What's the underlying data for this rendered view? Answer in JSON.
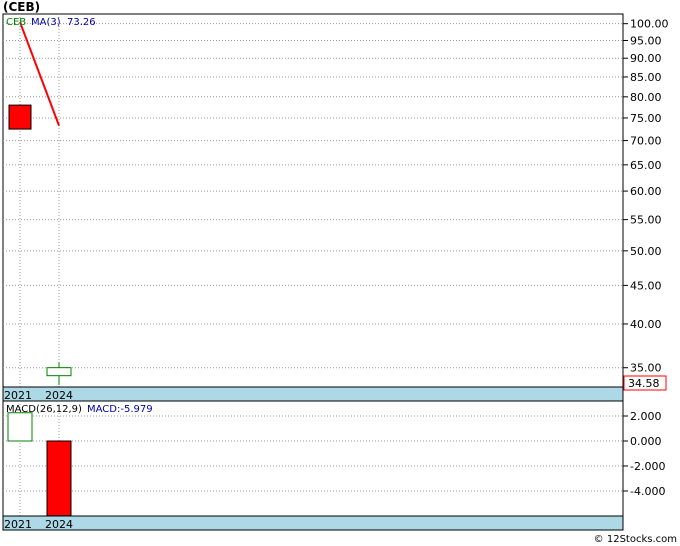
{
  "title": "(CEB)",
  "footer": "© 12Stocks.com",
  "chart_data": [
    {
      "type": "candlestick",
      "title": "(CEB)",
      "categories": [
        "2021",
        "2024"
      ],
      "legend": {
        "symbol": "CEB",
        "ma_label": "MA(3)",
        "ma_value": "73.26"
      },
      "candles": [
        {
          "x": "2021",
          "open": 78.0,
          "high": 78.0,
          "low": 72.5,
          "close": 72.5,
          "direction": "down"
        },
        {
          "x": "2024",
          "open": 33.2,
          "high": 35.6,
          "low": 33.2,
          "close": 34.58,
          "direction": "up"
        }
      ],
      "ma_line": [
        {
          "x": "2021",
          "y": 100.5
        },
        {
          "x": "2024",
          "y": 73.26
        }
      ],
      "y_ticks": [
        "100.00",
        "95.00",
        "90.00",
        "85.00",
        "80.00",
        "75.00",
        "70.00",
        "65.00",
        "60.00",
        "55.00",
        "50.00",
        "45.00",
        "40.00",
        "35.00"
      ],
      "y_tick_values": [
        100,
        95,
        90,
        85,
        80,
        75,
        70,
        65,
        60,
        55,
        50,
        45,
        40,
        35
      ],
      "last_price_label": "34.58",
      "ylim": [
        33,
        103
      ],
      "y_scale": "log",
      "grid": true,
      "colors": {
        "down": "#ff0000",
        "up": "#ffffff",
        "up_border": "#008000",
        "ma": "#ff0000",
        "axis_band": "#add8e6"
      }
    },
    {
      "type": "bar",
      "title": "MACD(26,12,9)",
      "categories": [
        "2021",
        "2024"
      ],
      "legend": {
        "label": "MACD(26,12,9)",
        "value_label": "MACD:-5.979"
      },
      "series": [
        {
          "values": [
            2.1,
            -5.979
          ]
        }
      ],
      "y_ticks": [
        "2.000",
        "0.000",
        "-2.000",
        "-4.000"
      ],
      "y_tick_values": [
        2,
        0,
        -2,
        -4
      ],
      "ylim": [
        -6.0,
        3.2
      ],
      "grid": true,
      "colors": {
        "negative": "#ff0000",
        "positive": "#ffffff",
        "positive_border": "#008000"
      }
    }
  ]
}
